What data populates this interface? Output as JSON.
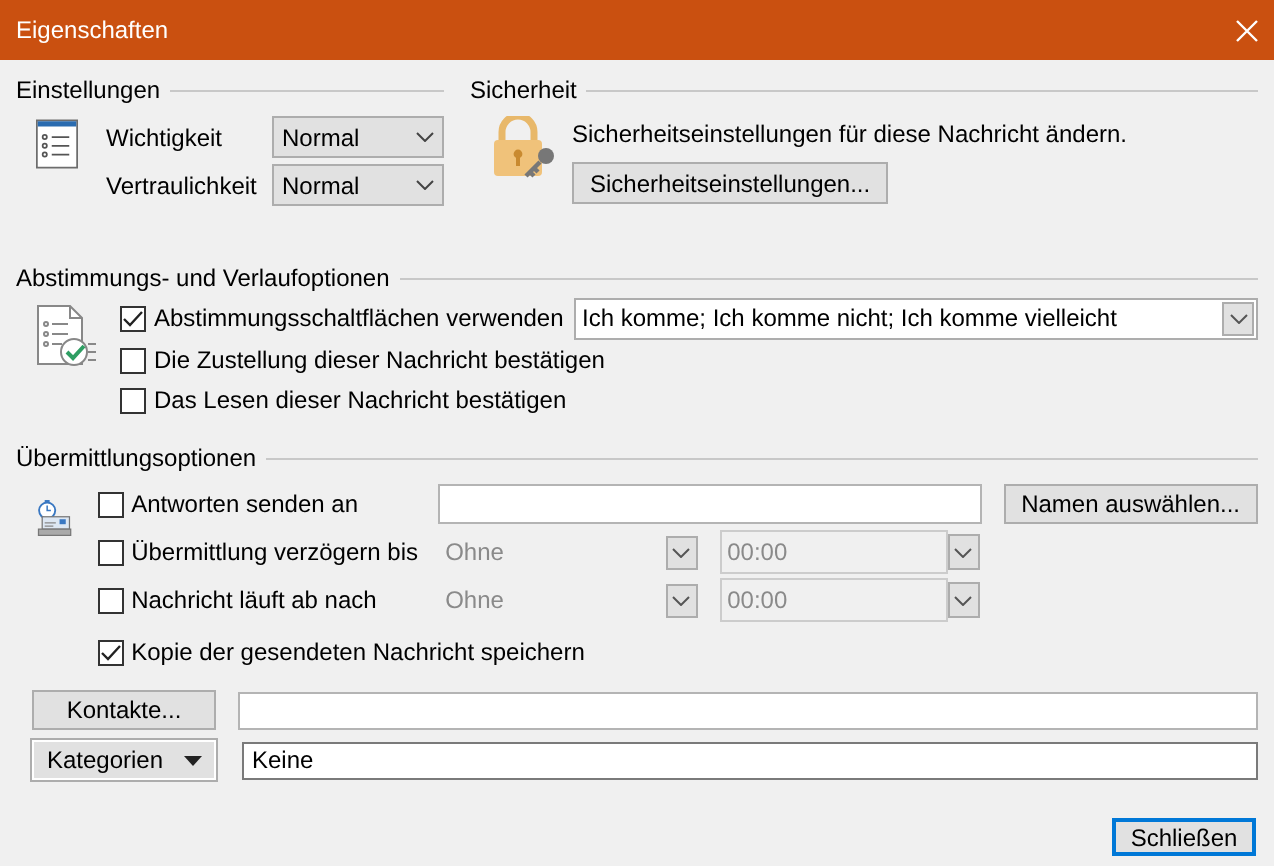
{
  "window": {
    "title": "Eigenschaften"
  },
  "settings": {
    "heading": "Einstellungen",
    "fields": [
      {
        "label": "Wichtigkeit",
        "value": "Normal"
      },
      {
        "label": "Vertraulichkeit",
        "value": "Normal"
      }
    ]
  },
  "security": {
    "heading": "Sicherheit",
    "description": "Sicherheitseinstellungen für diese Nachricht ändern.",
    "button": "Sicherheitseinstellungen..."
  },
  "voting": {
    "heading": "Abstimmungs- und Verlaufoptionen",
    "options": [
      {
        "label": "Abstimmungsschaltflächen verwenden",
        "checked": true,
        "choices": "Ich komme; Ich komme nicht; Ich komme vielleicht"
      },
      {
        "label": "Die Zustellung dieser Nachricht bestätigen",
        "checked": false
      },
      {
        "label": "Das Lesen dieser Nachricht bestätigen",
        "checked": false
      }
    ]
  },
  "delivery": {
    "heading": "Übermittlungsoptionen",
    "options": [
      {
        "kind": "address",
        "label": "Antworten senden an",
        "checked": false,
        "button": "Namen auswählen..."
      },
      {
        "kind": "datetime",
        "label": "Übermittlung verzögern bis",
        "checked": false,
        "disabled": true,
        "date": "Ohne",
        "time": "00:00"
      },
      {
        "kind": "datetime",
        "label": "Nachricht läuft ab nach",
        "checked": false,
        "disabled": true,
        "date": "Ohne",
        "time": "00:00"
      },
      {
        "kind": "plain",
        "label": "Kopie der gesendeten Nachricht speichern",
        "checked": true
      }
    ]
  },
  "contacts": {
    "button": "Kontakte..."
  },
  "categories": {
    "button": "Kategorien",
    "value": "Keine"
  },
  "buttons": [
    {
      "label": "Schließen",
      "default": true
    }
  ]
}
